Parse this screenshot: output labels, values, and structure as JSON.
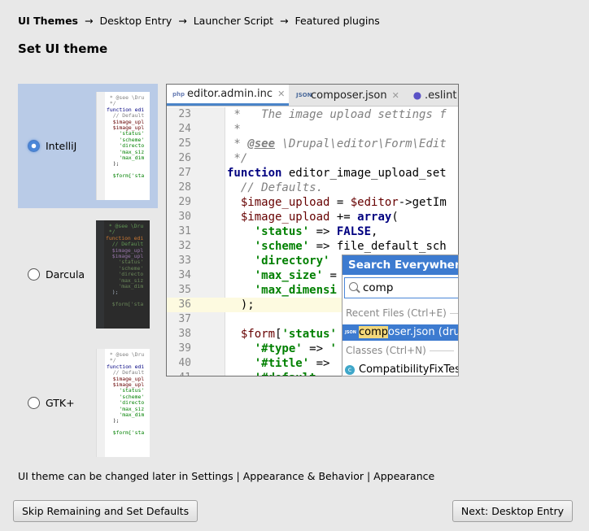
{
  "breadcrumb": {
    "current": "UI Themes",
    "separator": "→",
    "steps": [
      "Desktop Entry",
      "Launcher Script",
      "Featured plugins"
    ]
  },
  "heading": "Set UI theme",
  "themes": [
    {
      "label": "IntelliJ",
      "selected": true
    },
    {
      "label": "Darcula",
      "selected": false
    },
    {
      "label": "GTK+",
      "selected": false
    }
  ],
  "thumb": {
    "lines": [
      " * @see \\Dru",
      " */",
      "function edi",
      "  // Default",
      "  $image_upl",
      "  $image_upl",
      "    'status'",
      "    'scheme'",
      "    'directo",
      "    'max_siz",
      "    'max_dim",
      "  );",
      "",
      "  $form['sta"
    ]
  },
  "preview": {
    "tabs": [
      {
        "icon": "php",
        "label": "editor.admin.inc"
      },
      {
        "icon": "JSON",
        "label": "composer.json"
      },
      {
        "icon": "",
        "label": ".eslint"
      }
    ],
    "code_lines": [
      {
        "n": "23",
        "t": " *   The image upload settings f"
      },
      {
        "n": "24",
        "t": " *"
      },
      {
        "n": "25",
        "t": " * @see \\Drupal\\editor\\Form\\Edit"
      },
      {
        "n": "26",
        "t": " */"
      },
      {
        "n": "27",
        "t": "function editor_image_upload_set"
      },
      {
        "n": "28",
        "t": "  // Defaults."
      },
      {
        "n": "29",
        "t": "  $image_upload = $editor->getIm"
      },
      {
        "n": "30",
        "t": "  $image_upload += array("
      },
      {
        "n": "31",
        "t": "    'status' => FALSE,"
      },
      {
        "n": "32",
        "t": "    'scheme' => file_default_sch"
      },
      {
        "n": "33",
        "t": "    'directory'"
      },
      {
        "n": "34",
        "t": "    'max_size' ="
      },
      {
        "n": "35",
        "t": "    'max_dimensi"
      },
      {
        "n": "36",
        "t": "  );"
      },
      {
        "n": "37",
        "t": ""
      },
      {
        "n": "38",
        "t": "  $form['status'"
      },
      {
        "n": "39",
        "t": "    '#type' => '"
      },
      {
        "n": "40",
        "t": "    '#title' =>"
      },
      {
        "n": "41",
        "t": "    '#default"
      }
    ],
    "popup": {
      "title": "Search Everywhere:",
      "query": "comp",
      "recent_section": "Recent Files (Ctrl+E)",
      "recent_item_match": "comp",
      "recent_item_rest": "oser.json (dru",
      "classes_section": "Classes (Ctrl+N)",
      "class_item": "CompatibilityFixTes"
    }
  },
  "footnote": "UI theme can be changed later in Settings | Appearance & Behavior | Appearance",
  "buttons": {
    "skip": "Skip Remaining and Set Defaults",
    "next": "Next: Desktop Entry"
  },
  "colors": {
    "selection": "#b9cbe7",
    "accent": "#3d7bd0"
  }
}
